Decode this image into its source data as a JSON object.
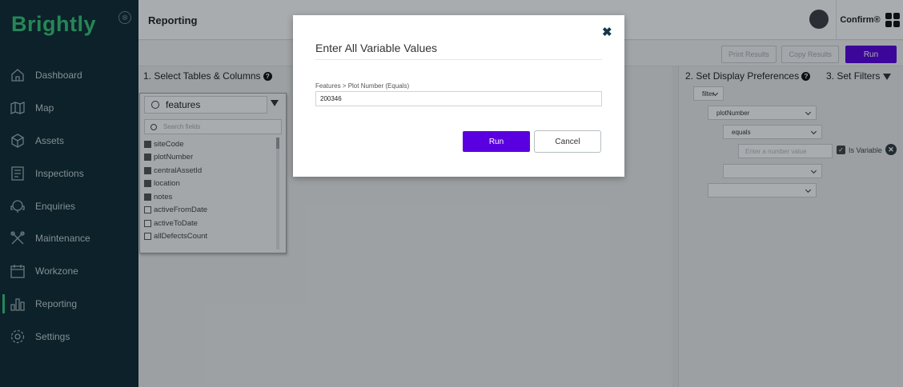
{
  "app": {
    "brand": "Brightly",
    "close_symbol": "⊗"
  },
  "sidebar": {
    "items": [
      {
        "label": "Dashboard",
        "icon": "home-icon"
      },
      {
        "label": "Map",
        "icon": "map-icon"
      },
      {
        "label": "Assets",
        "icon": "assets-icon"
      },
      {
        "label": "Inspections",
        "icon": "inspections-icon"
      },
      {
        "label": "Enquiries",
        "icon": "enquiries-icon"
      },
      {
        "label": "Maintenance",
        "icon": "maintenance-icon"
      },
      {
        "label": "Workzone",
        "icon": "calendar-icon"
      },
      {
        "label": "Reporting",
        "icon": "reporting-icon",
        "active": true
      },
      {
        "label": "Settings",
        "icon": "settings-icon"
      }
    ]
  },
  "header": {
    "title": "Reporting",
    "product": "Confirm®"
  },
  "toolbar": {
    "print_label": "Print Results",
    "copy_label": "Copy Results",
    "run_label": "Run"
  },
  "left_panel": {
    "title": "1. Select Tables & Columns",
    "table_search_value": "features",
    "field_search_placeholder": "Search fields",
    "fields": [
      {
        "label": "siteCode",
        "checked": true
      },
      {
        "label": "plotNumber",
        "checked": true
      },
      {
        "label": "centralAssetId",
        "checked": true
      },
      {
        "label": "location",
        "checked": true
      },
      {
        "label": "notes",
        "checked": true
      },
      {
        "label": "activeFromDate",
        "checked": false
      },
      {
        "label": "activeToDate",
        "checked": false
      },
      {
        "label": "allDefectsCount",
        "checked": false
      }
    ]
  },
  "right_panel": {
    "display_title": "2. Set Display Preferences",
    "filters_title": "3. Set Filters",
    "filter_type": "filter",
    "field_select": "plotNumber",
    "operator_select": "equals",
    "value_placeholder": "Enter a number value",
    "is_variable_label": "Is Variable",
    "empty_select_1": "",
    "empty_select_2": ""
  },
  "modal": {
    "title": "Enter All Variable Values",
    "field_label": "Features > Plot Number (Equals)",
    "field_value": "200346",
    "run_label": "Run",
    "cancel_label": "Cancel"
  },
  "colors": {
    "accent": "#5a00e0",
    "brand_green": "#36c57a",
    "sidebar_bg": "#0f2a33"
  }
}
